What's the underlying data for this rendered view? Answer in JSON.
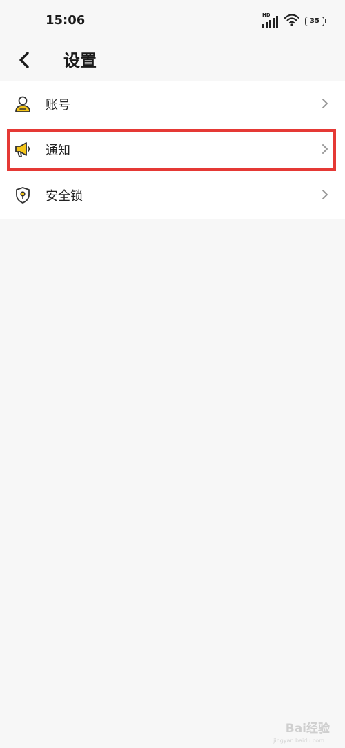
{
  "status_bar": {
    "time": "15:06",
    "hd_label": "HD",
    "battery_level": "35"
  },
  "header": {
    "title": "设置"
  },
  "settings": {
    "items": [
      {
        "label": "账号",
        "icon": "user-icon"
      },
      {
        "label": "通知",
        "icon": "megaphone-icon"
      },
      {
        "label": "安全锁",
        "icon": "shield-key-icon"
      }
    ]
  },
  "highlight": {
    "target": "通知",
    "color": "#e53935"
  },
  "colors": {
    "accent": "#f5c518",
    "background": "#f7f7f7",
    "list_background": "#ffffff"
  },
  "watermark": {
    "text": "Bai经验",
    "sub": "jingyan.baidu.com"
  }
}
